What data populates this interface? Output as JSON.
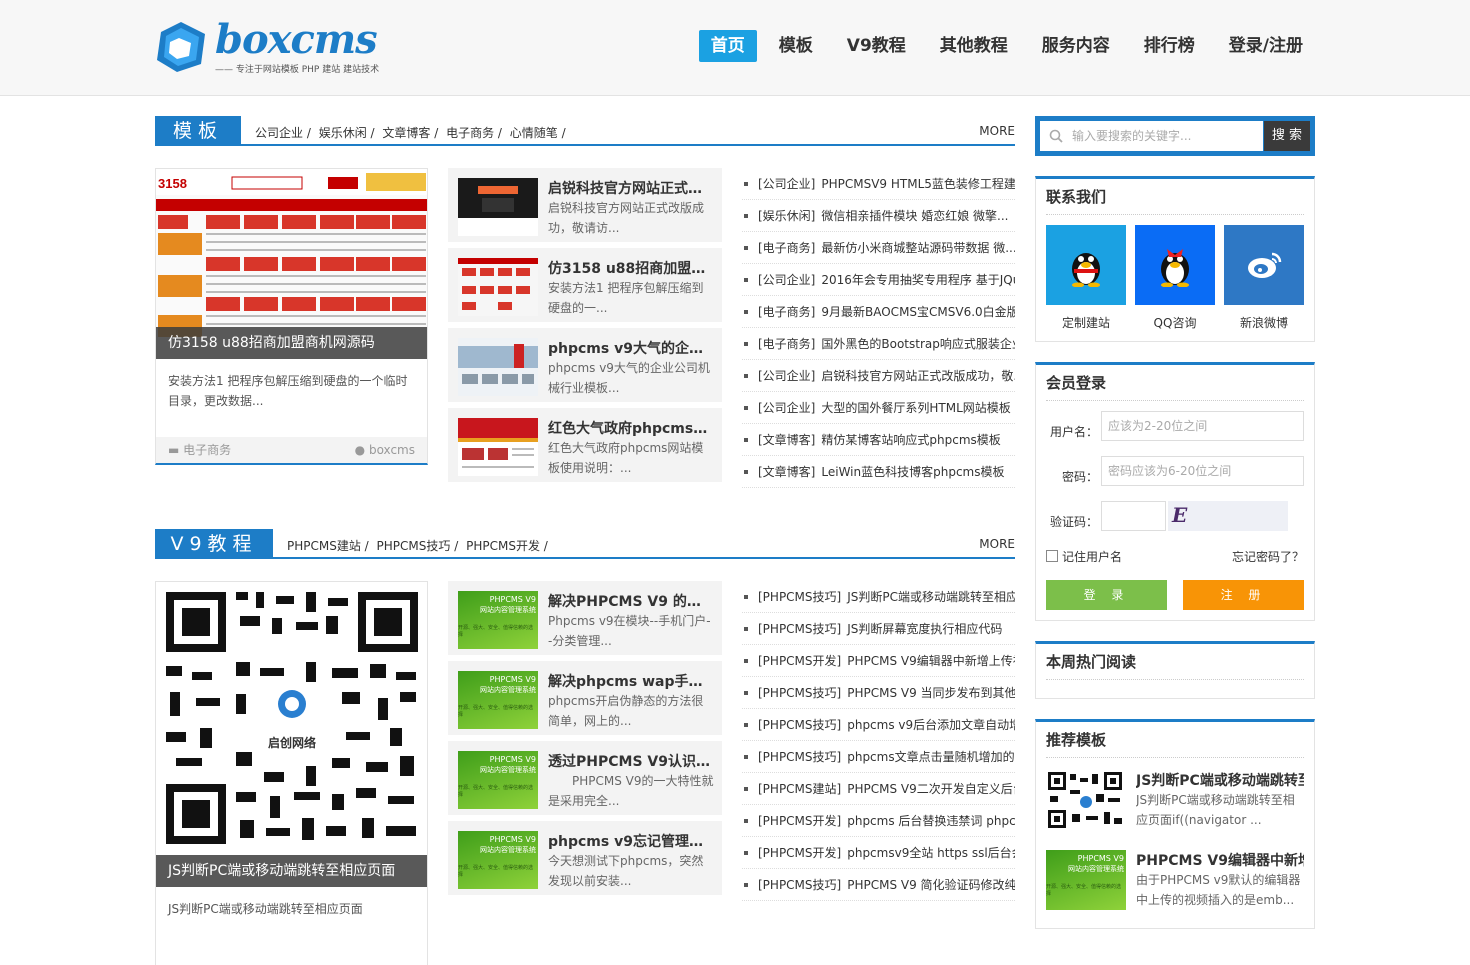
{
  "header": {
    "brand": "boxcms",
    "slogan": "—— 专注于网站模板 PHP 建站 建站技术",
    "nav": [
      "首页",
      "模板",
      "V9教程",
      "其他教程",
      "服务内容",
      "排行榜",
      "登录/注册"
    ]
  },
  "section1": {
    "title": "模板",
    "cats": [
      "公司企业 /",
      "娱乐休闲 /",
      "文章博客 /",
      "电子商务 /",
      "心情随笔 /"
    ],
    "more": "MORE",
    "feature": {
      "caption": "仿3158 u88招商加盟商机网源码",
      "desc": "安装方法1 把程序包解压缩到硬盘的一个临时目录，更改数据...",
      "category": "电子商务",
      "author": "boxcms"
    },
    "mid": [
      {
        "title": "启锐科技官方网站正式改版成功",
        "desc": "启锐科技官方网站正式改版成功，敬请访..."
      },
      {
        "title": "仿3158 u88招商加盟商机网源码",
        "desc": "安装方法1 把程序包解压缩到硬盘的一..."
      },
      {
        "title": "phpcms v9大气的企业公司模板",
        "desc": "phpcms v9大气的企业公司机械行业模板..."
      },
      {
        "title": "红色大气政府phpcms网站模板",
        "desc": "红色大气政府phpcms网站模板使用说明：..."
      }
    ],
    "list": [
      {
        "tag": "[公司企业]",
        "text": "PHPCMSV9 HTML5蓝色装修工程建"
      },
      {
        "tag": "[娱乐休闲]",
        "text": "微信相亲插件模块 婚恋红娘 微擎..."
      },
      {
        "tag": "[电子商务]",
        "text": "最新仿小米商城整站源码带数据 微..."
      },
      {
        "tag": "[公司企业]",
        "text": "2016年会专用抽奖专用程序 基于JQu"
      },
      {
        "tag": "[电子商务]",
        "text": "9月最新BAOCMS宝CMSV6.0白金版"
      },
      {
        "tag": "[电子商务]",
        "text": "国外黑色的Bootstrap响应式服装企业"
      },
      {
        "tag": "[公司企业]",
        "text": "启锐科技官方网站正式改版成功，敬..."
      },
      {
        "tag": "[公司企业]",
        "text": "大型的国外餐厅系列HTML网站模板"
      },
      {
        "tag": "[文章博客]",
        "text": "精仿某博客站响应式phpcms模板"
      },
      {
        "tag": "[文章博客]",
        "text": "LeiWin蓝色科技博客phpcms模板"
      }
    ]
  },
  "section2": {
    "title": "V9教程",
    "cats": [
      "PHPCMS建站 /",
      "PHPCMS技巧 /",
      "PHPCMS开发 /"
    ],
    "more": "MORE",
    "feature": {
      "caption": "JS判断PC端或移动端跳转至相应页面",
      "desc": "JS判断PC端或移动端跳转至相应页面",
      "logo_text": "启创网络"
    },
    "mid": [
      {
        "title": "解决PHPCMS V9 的手机门户问题",
        "desc": "Phpcms v9在模块--手机门户--分类管理..."
      },
      {
        "title": "解决phpcms wap手机站伪静态",
        "desc": "phpcms开启伪静态的方法很简单，网上的..."
      },
      {
        "title": "透过PHPCMS V9认识MVC",
        "desc": "　　PHPCMS V9的一大特性就是采用完全..."
      },
      {
        "title": "phpcms v9忘记管理员后台密码",
        "desc": "今天想测试下phpcms，突然发现以前安装..."
      }
    ],
    "thumb_text": {
      "l1": "PHPCMS V9",
      "l2": "网站内容管理系统",
      "l3": "开源、强大、安全、值得信赖的选择"
    },
    "list": [
      {
        "tag": "[PHPCMS技巧]",
        "text": "JS判断PC端或移动端跳转至相应"
      },
      {
        "tag": "[PHPCMS技巧]",
        "text": "JS判断屏幕宽度执行相应代码"
      },
      {
        "tag": "[PHPCMS开发]",
        "text": "PHPCMS V9编辑器中新增上传视频"
      },
      {
        "tag": "[PHPCMS技巧]",
        "text": "PHPCMS V9 当同步发布到其他栏目"
      },
      {
        "tag": "[PHPCMS技巧]",
        "text": "phpcms v9后台添加文章自动增加"
      },
      {
        "tag": "[PHPCMS技巧]",
        "text": "phpcms文章点击量随机增加的方法"
      },
      {
        "tag": "[PHPCMS建站]",
        "text": "PHPCMS V9二次开发自定义后台"
      },
      {
        "tag": "[PHPCMS开发]",
        "text": "phpcms 后台替换违禁词 phpcms"
      },
      {
        "tag": "[PHPCMS开发]",
        "text": "phpcmsv9全站 https ssl后台会员登"
      },
      {
        "tag": "[PHPCMS技巧]",
        "text": "PHPCMS V9 简化验证码修改纯数字"
      }
    ]
  },
  "sidebar": {
    "search": {
      "placeholder": "输入要搜索的关键字...",
      "button": "搜 索"
    },
    "contact": {
      "title": "联系我们",
      "items": [
        "定制建站",
        "QQ咨询",
        "新浪微博"
      ],
      "colors": [
        "#1ba1e2",
        "#0a6cf5",
        "#2e78c5"
      ]
    },
    "login": {
      "title": "会员登录",
      "user_label": "用户名：",
      "user_placeholder": "应该为2-20位之间",
      "pass_label": "密码：",
      "pass_placeholder": "密码应该为6-20位之间",
      "code_label": "验证码：",
      "remember": "记住用户名",
      "forgot": "忘记密码了？",
      "login_btn": "登 录",
      "register_btn": "注 册",
      "captcha": "E LAK"
    },
    "hot": {
      "title": "本周热门阅读"
    },
    "recommend": {
      "title": "推荐模板",
      "items": [
        {
          "title": "JS判断PC端或移动端跳转至相应页面",
          "desc": "JS判断PC端或移动端跳转至相应页面if((navigator ..."
        },
        {
          "title": "PHPCMS V9编辑器中新增上传视频",
          "desc": "由于PHPCMS v9默认的编辑器中上传的视频插入的是emb..."
        }
      ]
    }
  }
}
